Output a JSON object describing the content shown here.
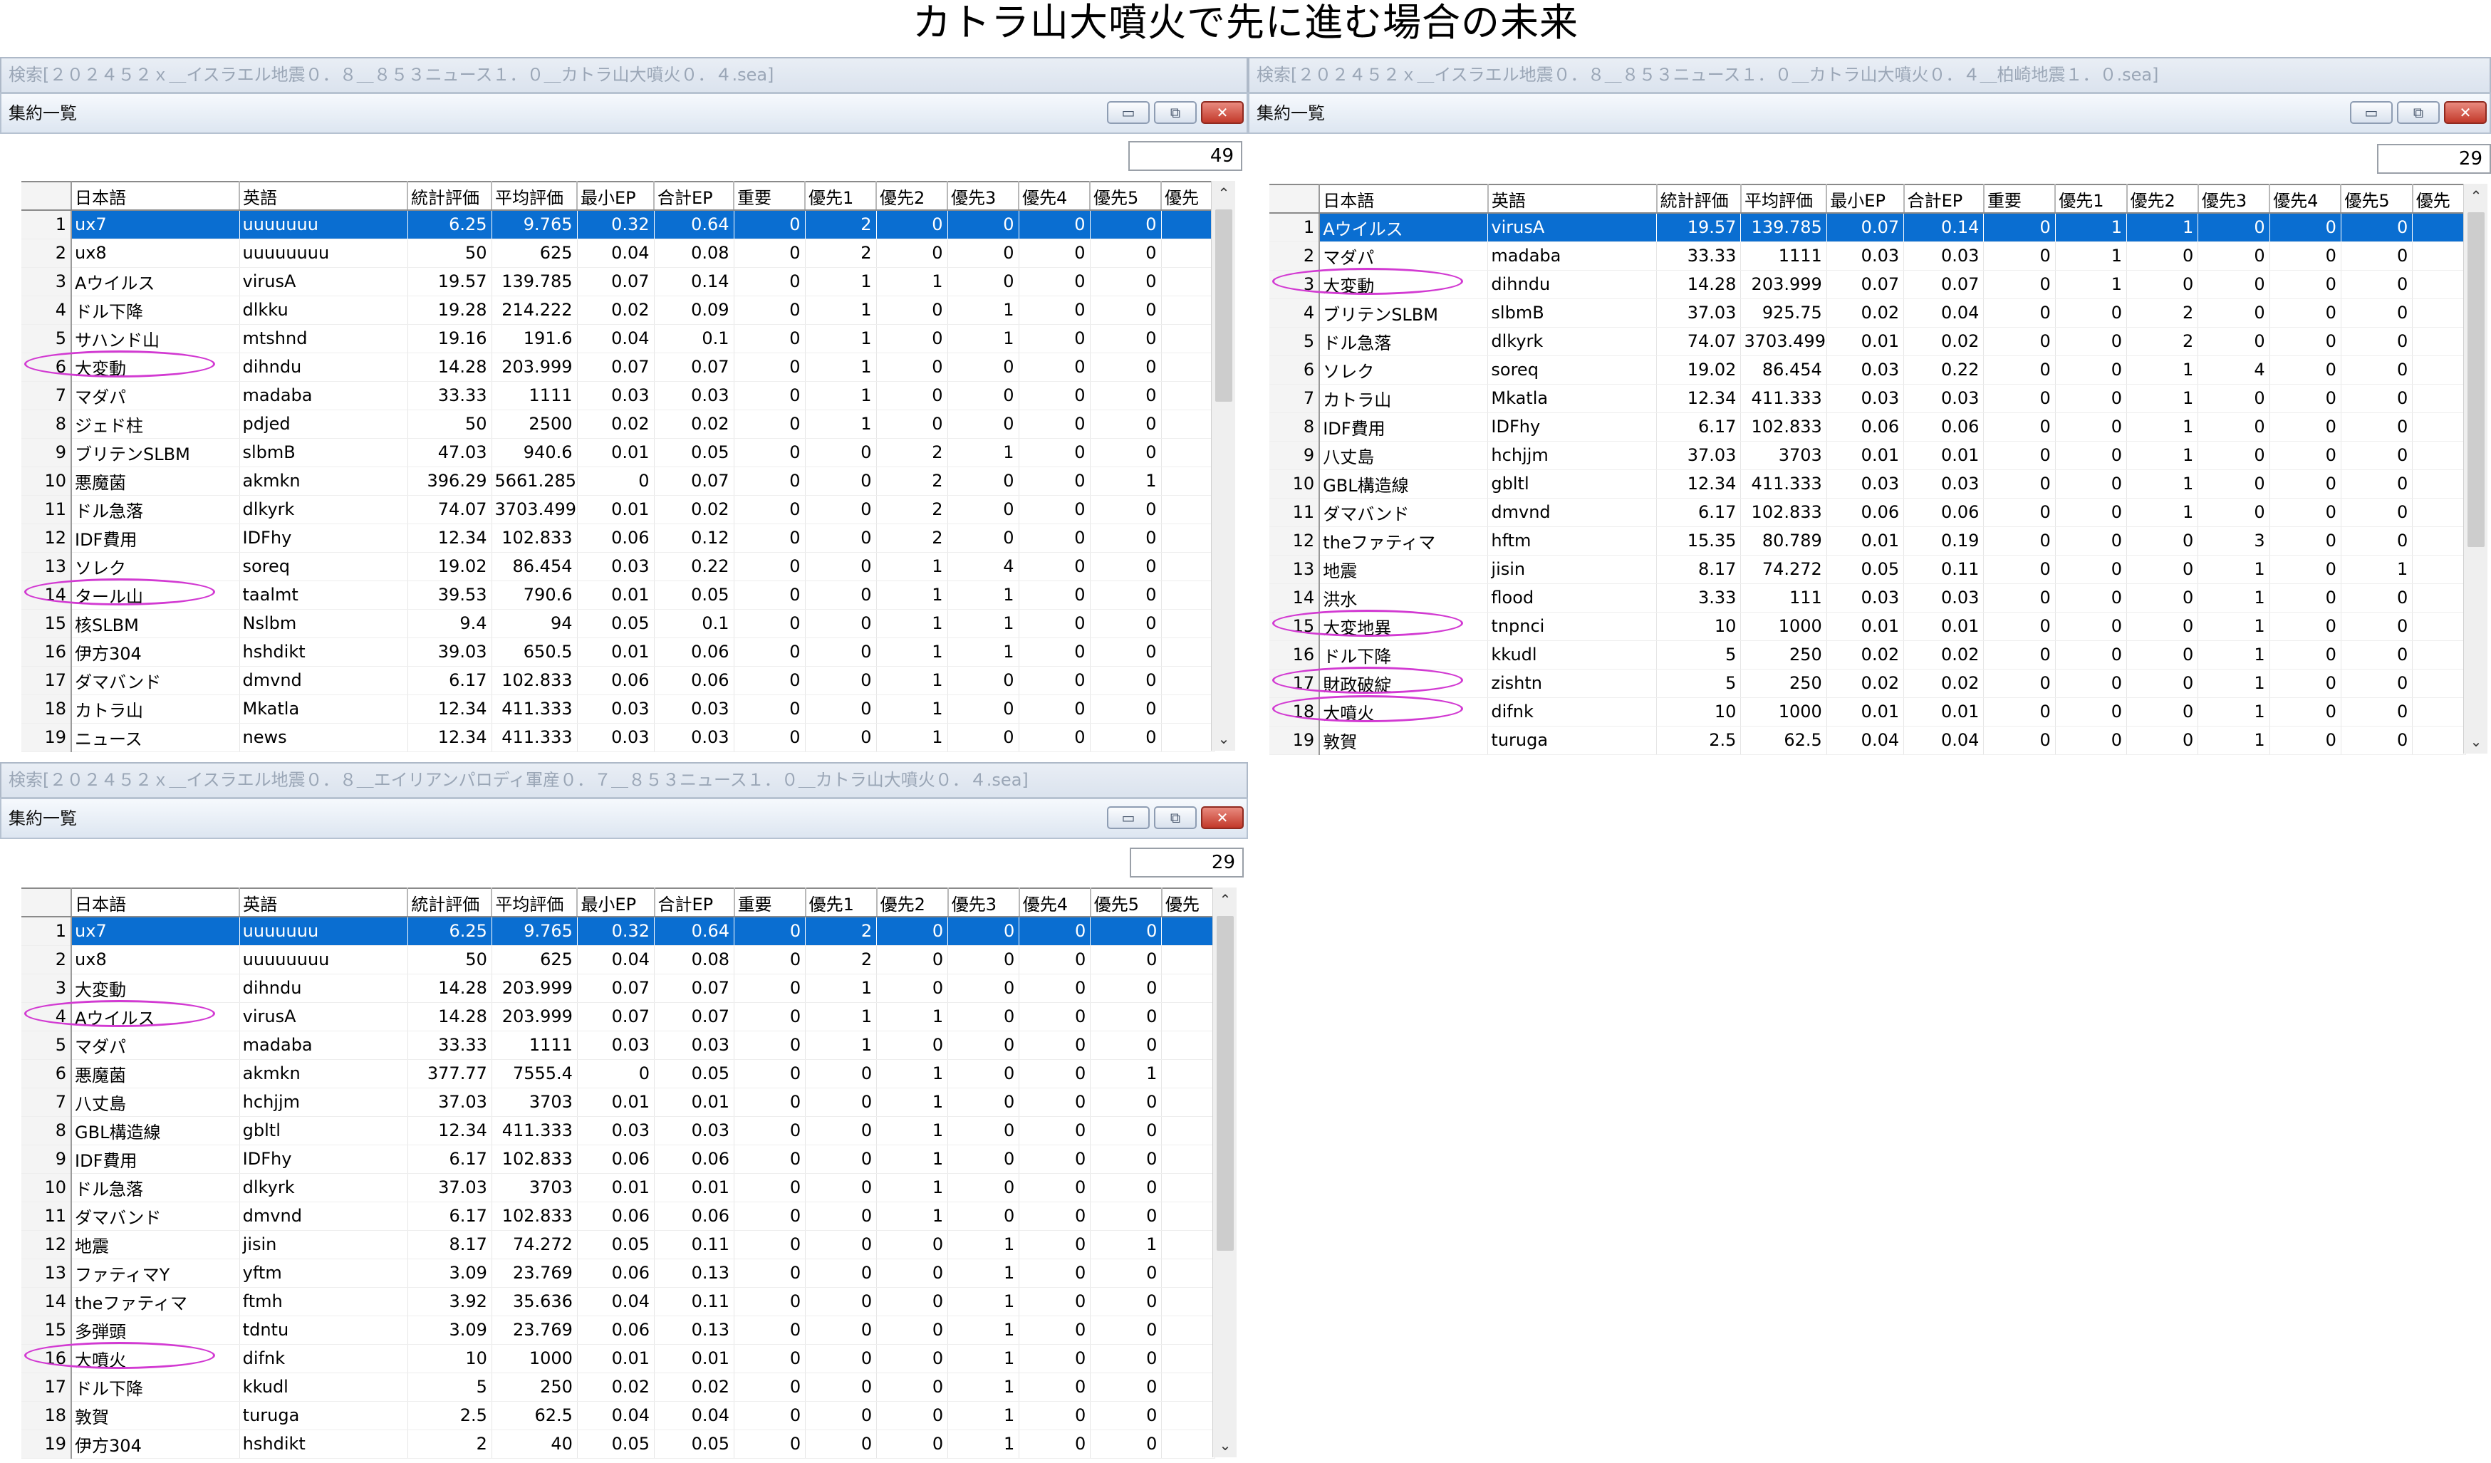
{
  "page_title": "カトラ山大噴火で先に進む場合の未来",
  "window_title": "集約一覧",
  "columns": [
    "",
    "日本語",
    "英語",
    "統計評価",
    "平均評価",
    "最小EP",
    "合計EP",
    "重要",
    "優先1",
    "優先2",
    "優先3",
    "優先4",
    "優先5",
    "優先"
  ],
  "window_buttons": {
    "minimize": "▭",
    "restore": "⧉",
    "close": "✕"
  },
  "highlight_color": "#d23ad2",
  "selection_color": "#0a6ed1",
  "windows": [
    {
      "search": "検索[２０２４５２ｘ＿イスラエル地震０．８＿８５３ニュース１．０＿カトラ山大噴火０．４.sea]",
      "count": "49",
      "selected_row": 1,
      "rows": [
        [
          "1",
          "ux7",
          "uuuuuuu",
          "6.25",
          "9.765",
          "0.32",
          "0.64",
          "0",
          "2",
          "0",
          "0",
          "0",
          "0",
          ""
        ],
        [
          "2",
          "ux8",
          "uuuuuuuu",
          "50",
          "625",
          "0.04",
          "0.08",
          "0",
          "2",
          "0",
          "0",
          "0",
          "0",
          ""
        ],
        [
          "3",
          "Aウイルス",
          "virusA",
          "19.57",
          "139.785",
          "0.07",
          "0.14",
          "0",
          "1",
          "1",
          "0",
          "0",
          "0",
          ""
        ],
        [
          "4",
          "ドル下降",
          "dlkku",
          "19.28",
          "214.222",
          "0.02",
          "0.09",
          "0",
          "1",
          "0",
          "1",
          "0",
          "0",
          ""
        ],
        [
          "5",
          "サハンド山",
          "mtshnd",
          "19.16",
          "191.6",
          "0.04",
          "0.1",
          "0",
          "1",
          "0",
          "1",
          "0",
          "0",
          ""
        ],
        [
          "6",
          "大変動",
          "dihndu",
          "14.28",
          "203.999",
          "0.07",
          "0.07",
          "0",
          "1",
          "0",
          "0",
          "0",
          "0",
          ""
        ],
        [
          "7",
          "マダパ",
          "madaba",
          "33.33",
          "1111",
          "0.03",
          "0.03",
          "0",
          "1",
          "0",
          "0",
          "0",
          "0",
          ""
        ],
        [
          "8",
          "ジェド柱",
          "pdjed",
          "50",
          "2500",
          "0.02",
          "0.02",
          "0",
          "1",
          "0",
          "0",
          "0",
          "0",
          ""
        ],
        [
          "9",
          "ブリテンSLBM",
          "slbmB",
          "47.03",
          "940.6",
          "0.01",
          "0.05",
          "0",
          "0",
          "2",
          "1",
          "0",
          "0",
          ""
        ],
        [
          "10",
          "悪魔菌",
          "akmkn",
          "396.29",
          "5661.285",
          "0",
          "0.07",
          "0",
          "0",
          "2",
          "0",
          "0",
          "1",
          ""
        ],
        [
          "11",
          "ドル急落",
          "dlkyrk",
          "74.07",
          "3703.499",
          "0.01",
          "0.02",
          "0",
          "0",
          "2",
          "0",
          "0",
          "0",
          ""
        ],
        [
          "12",
          "IDF費用",
          "IDFhy",
          "12.34",
          "102.833",
          "0.06",
          "0.12",
          "0",
          "0",
          "2",
          "0",
          "0",
          "0",
          ""
        ],
        [
          "13",
          "ソレク",
          "soreq",
          "19.02",
          "86.454",
          "0.03",
          "0.22",
          "0",
          "0",
          "1",
          "4",
          "0",
          "0",
          ""
        ],
        [
          "14",
          "タール山",
          "taalmt",
          "39.53",
          "790.6",
          "0.01",
          "0.05",
          "0",
          "0",
          "1",
          "1",
          "0",
          "0",
          ""
        ],
        [
          "15",
          "核SLBM",
          "Nslbm",
          "9.4",
          "94",
          "0.05",
          "0.1",
          "0",
          "0",
          "1",
          "1",
          "0",
          "0",
          ""
        ],
        [
          "16",
          "伊方304",
          "hshdikt",
          "39.03",
          "650.5",
          "0.01",
          "0.06",
          "0",
          "0",
          "1",
          "1",
          "0",
          "0",
          ""
        ],
        [
          "17",
          "ダマバンド",
          "dmvnd",
          "6.17",
          "102.833",
          "0.06",
          "0.06",
          "0",
          "0",
          "1",
          "0",
          "0",
          "0",
          ""
        ],
        [
          "18",
          "カトラ山",
          "Mkatla",
          "12.34",
          "411.333",
          "0.03",
          "0.03",
          "0",
          "0",
          "1",
          "0",
          "0",
          "0",
          ""
        ],
        [
          "19",
          "ニュース",
          "news",
          "12.34",
          "411.333",
          "0.03",
          "0.03",
          "0",
          "0",
          "1",
          "0",
          "0",
          "0",
          ""
        ]
      ]
    },
    {
      "search": "検索[２０２４５２ｘ＿イスラエル地震０．８＿８５３ニュース１．０＿カトラ山大噴火０．４＿柏崎地震１．０.sea]",
      "count": "29",
      "selected_row": 1,
      "rows": [
        [
          "1",
          "Aウイルス",
          "virusA",
          "19.57",
          "139.785",
          "0.07",
          "0.14",
          "0",
          "1",
          "1",
          "0",
          "0",
          "0",
          ""
        ],
        [
          "2",
          "マダパ",
          "madaba",
          "33.33",
          "1111",
          "0.03",
          "0.03",
          "0",
          "1",
          "0",
          "0",
          "0",
          "0",
          ""
        ],
        [
          "3",
          "大変動",
          "dihndu",
          "14.28",
          "203.999",
          "0.07",
          "0.07",
          "0",
          "1",
          "0",
          "0",
          "0",
          "0",
          ""
        ],
        [
          "4",
          "ブリテンSLBM",
          "slbmB",
          "37.03",
          "925.75",
          "0.02",
          "0.04",
          "0",
          "0",
          "2",
          "0",
          "0",
          "0",
          ""
        ],
        [
          "5",
          "ドル急落",
          "dlkyrk",
          "74.07",
          "3703.499",
          "0.01",
          "0.02",
          "0",
          "0",
          "2",
          "0",
          "0",
          "0",
          ""
        ],
        [
          "6",
          "ソレク",
          "soreq",
          "19.02",
          "86.454",
          "0.03",
          "0.22",
          "0",
          "0",
          "1",
          "4",
          "0",
          "0",
          ""
        ],
        [
          "7",
          "カトラ山",
          "Mkatla",
          "12.34",
          "411.333",
          "0.03",
          "0.03",
          "0",
          "0",
          "1",
          "0",
          "0",
          "0",
          ""
        ],
        [
          "8",
          "IDF費用",
          "IDFhy",
          "6.17",
          "102.833",
          "0.06",
          "0.06",
          "0",
          "0",
          "1",
          "0",
          "0",
          "0",
          ""
        ],
        [
          "9",
          "八丈島",
          "hchjjm",
          "37.03",
          "3703",
          "0.01",
          "0.01",
          "0",
          "0",
          "1",
          "0",
          "0",
          "0",
          ""
        ],
        [
          "10",
          "GBL構造線",
          "gbltl",
          "12.34",
          "411.333",
          "0.03",
          "0.03",
          "0",
          "0",
          "1",
          "0",
          "0",
          "0",
          ""
        ],
        [
          "11",
          "ダマバンド",
          "dmvnd",
          "6.17",
          "102.833",
          "0.06",
          "0.06",
          "0",
          "0",
          "1",
          "0",
          "0",
          "0",
          ""
        ],
        [
          "12",
          "theファティマ",
          "hftm",
          "15.35",
          "80.789",
          "0.01",
          "0.19",
          "0",
          "0",
          "0",
          "3",
          "0",
          "0",
          ""
        ],
        [
          "13",
          "地震",
          "jisin",
          "8.17",
          "74.272",
          "0.05",
          "0.11",
          "0",
          "0",
          "0",
          "1",
          "0",
          "1",
          ""
        ],
        [
          "14",
          "洪水",
          "flood",
          "3.33",
          "111",
          "0.03",
          "0.03",
          "0",
          "0",
          "0",
          "1",
          "0",
          "0",
          ""
        ],
        [
          "15",
          "大変地異",
          "tnpnci",
          "10",
          "1000",
          "0.01",
          "0.01",
          "0",
          "0",
          "0",
          "1",
          "0",
          "0",
          ""
        ],
        [
          "16",
          "ドル下降",
          "kkudl",
          "5",
          "250",
          "0.02",
          "0.02",
          "0",
          "0",
          "0",
          "1",
          "0",
          "0",
          ""
        ],
        [
          "17",
          "財政破綻",
          "zishtn",
          "5",
          "250",
          "0.02",
          "0.02",
          "0",
          "0",
          "0",
          "1",
          "0",
          "0",
          ""
        ],
        [
          "18",
          "大噴火",
          "difnk",
          "10",
          "1000",
          "0.01",
          "0.01",
          "0",
          "0",
          "0",
          "1",
          "0",
          "0",
          ""
        ],
        [
          "19",
          "敦賀",
          "turuga",
          "2.5",
          "62.5",
          "0.04",
          "0.04",
          "0",
          "0",
          "0",
          "1",
          "0",
          "0",
          ""
        ]
      ]
    },
    {
      "search": "検索[２０２４５２ｘ＿イスラエル地震０．８＿エイリアンパロディ軍産０．７＿８５３ニュース１．０＿カトラ山大噴火０．４.sea]",
      "count": "29",
      "selected_row": 1,
      "rows": [
        [
          "1",
          "ux7",
          "uuuuuuu",
          "6.25",
          "9.765",
          "0.32",
          "0.64",
          "0",
          "2",
          "0",
          "0",
          "0",
          "0",
          ""
        ],
        [
          "2",
          "ux8",
          "uuuuuuuu",
          "50",
          "625",
          "0.04",
          "0.08",
          "0",
          "2",
          "0",
          "0",
          "0",
          "0",
          ""
        ],
        [
          "3",
          "大変動",
          "dihndu",
          "14.28",
          "203.999",
          "0.07",
          "0.07",
          "0",
          "1",
          "0",
          "0",
          "0",
          "0",
          ""
        ],
        [
          "4",
          "Aウイルス",
          "virusA",
          "14.28",
          "203.999",
          "0.07",
          "0.07",
          "0",
          "1",
          "1",
          "0",
          "0",
          "0",
          ""
        ],
        [
          "5",
          "マダパ",
          "madaba",
          "33.33",
          "1111",
          "0.03",
          "0.03",
          "0",
          "1",
          "0",
          "0",
          "0",
          "0",
          ""
        ],
        [
          "6",
          "悪魔菌",
          "akmkn",
          "377.77",
          "7555.4",
          "0",
          "0.05",
          "0",
          "0",
          "1",
          "0",
          "0",
          "1",
          ""
        ],
        [
          "7",
          "八丈島",
          "hchjjm",
          "37.03",
          "3703",
          "0.01",
          "0.01",
          "0",
          "0",
          "1",
          "0",
          "0",
          "0",
          ""
        ],
        [
          "8",
          "GBL構造線",
          "gbltl",
          "12.34",
          "411.333",
          "0.03",
          "0.03",
          "0",
          "0",
          "1",
          "0",
          "0",
          "0",
          ""
        ],
        [
          "9",
          "IDF費用",
          "IDFhy",
          "6.17",
          "102.833",
          "0.06",
          "0.06",
          "0",
          "0",
          "1",
          "0",
          "0",
          "0",
          ""
        ],
        [
          "10",
          "ドル急落",
          "dlkyrk",
          "37.03",
          "3703",
          "0.01",
          "0.01",
          "0",
          "0",
          "1",
          "0",
          "0",
          "0",
          ""
        ],
        [
          "11",
          "ダマバンド",
          "dmvnd",
          "6.17",
          "102.833",
          "0.06",
          "0.06",
          "0",
          "0",
          "1",
          "0",
          "0",
          "0",
          ""
        ],
        [
          "12",
          "地震",
          "jisin",
          "8.17",
          "74.272",
          "0.05",
          "0.11",
          "0",
          "0",
          "0",
          "1",
          "0",
          "1",
          ""
        ],
        [
          "13",
          "ファティマY",
          "yftm",
          "3.09",
          "23.769",
          "0.06",
          "0.13",
          "0",
          "0",
          "0",
          "1",
          "0",
          "0",
          ""
        ],
        [
          "14",
          "theファティマ",
          "ftmh",
          "3.92",
          "35.636",
          "0.04",
          "0.11",
          "0",
          "0",
          "0",
          "1",
          "0",
          "0",
          ""
        ],
        [
          "15",
          "多弾頭",
          "tdntu",
          "3.09",
          "23.769",
          "0.06",
          "0.13",
          "0",
          "0",
          "0",
          "1",
          "0",
          "0",
          ""
        ],
        [
          "16",
          "大噴火",
          "difnk",
          "10",
          "1000",
          "0.01",
          "0.01",
          "0",
          "0",
          "0",
          "1",
          "0",
          "0",
          ""
        ],
        [
          "17",
          "ドル下降",
          "kkudl",
          "5",
          "250",
          "0.02",
          "0.02",
          "0",
          "0",
          "0",
          "1",
          "0",
          "0",
          ""
        ],
        [
          "18",
          "敦賀",
          "turuga",
          "2.5",
          "62.5",
          "0.04",
          "0.04",
          "0",
          "0",
          "0",
          "1",
          "0",
          "0",
          ""
        ],
        [
          "19",
          "伊方304",
          "hshdikt",
          "2",
          "40",
          "0.05",
          "0.05",
          "0",
          "0",
          "0",
          "1",
          "0",
          "0",
          ""
        ]
      ]
    }
  ],
  "circled_rows": [
    [
      6,
      14
    ],
    [
      3,
      15,
      17,
      18
    ],
    [
      4,
      16
    ]
  ]
}
